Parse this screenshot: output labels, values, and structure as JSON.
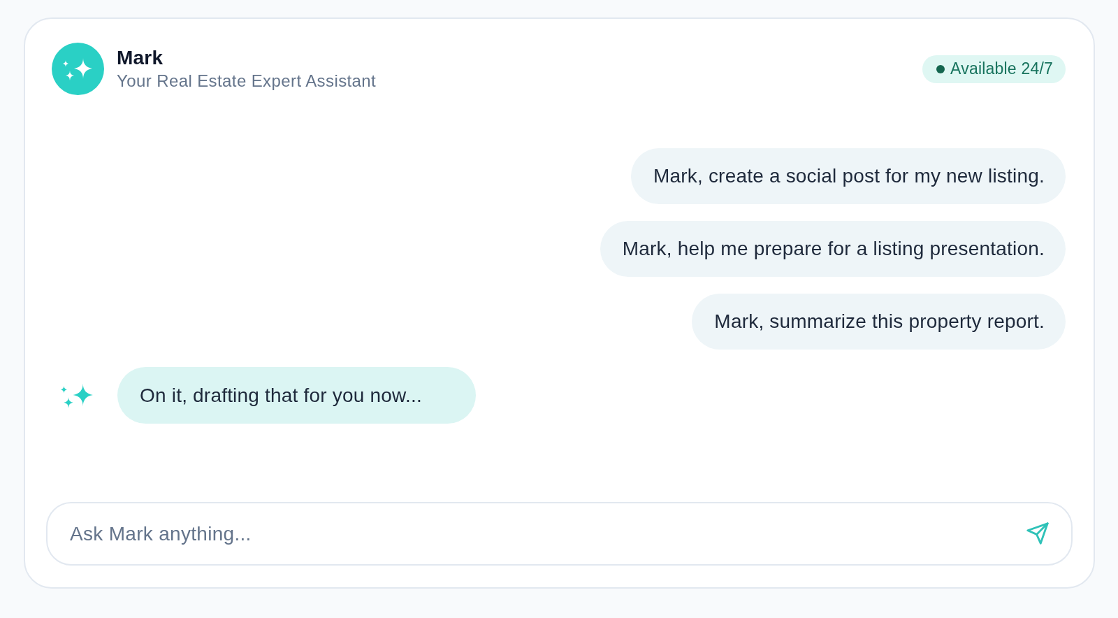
{
  "assistant": {
    "name": "Mark",
    "subtitle": "Your Real Estate Expert Assistant"
  },
  "status_badge": {
    "label": "Available 24/7"
  },
  "messages": [
    {
      "kind": "user",
      "text": "Mark, create a social post for my new listing."
    },
    {
      "kind": "user",
      "text": "Mark, help me prepare for a listing presentation."
    },
    {
      "kind": "user",
      "text": "Mark, summarize this property report."
    },
    {
      "kind": "assistant",
      "text": "On it, drafting that for you now..."
    }
  ],
  "input": {
    "placeholder": "Ask Mark anything..."
  }
}
